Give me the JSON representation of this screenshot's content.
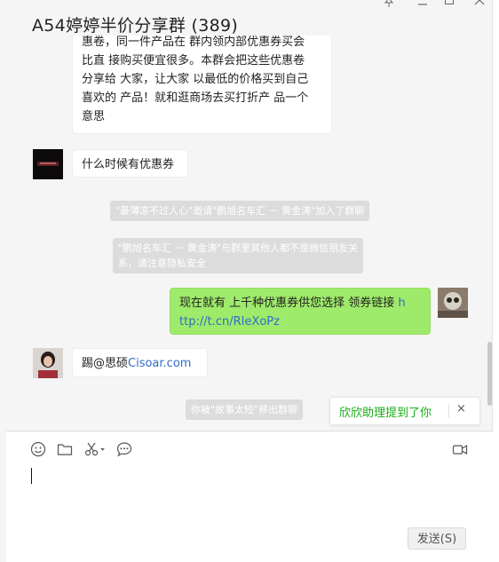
{
  "window": {
    "title": "A54婷婷半价分享群 (389)",
    "controls": [
      "pin",
      "minimize",
      "maximize",
      "close"
    ]
  },
  "messages": [
    {
      "type": "text",
      "side": "left",
      "lines": [
        "惠卷，同一件产品在 群内领内部优惠券买会",
        "比直 接购买便宜很多。本群会把这些优惠卷",
        "分享给 大家，让大家 以最低的价格买到自己",
        "喜欢的 产品！就和逛商场去买打折产 品一个",
        "意思"
      ]
    },
    {
      "type": "text",
      "side": "left",
      "avatar": "dark-avatar",
      "text": "什么时候有优惠券"
    },
    {
      "type": "system",
      "text": "\"最薄凉不过人心\"邀请\"鹏旭名车汇 － 黄金涛\"加入了群聊"
    },
    {
      "type": "system",
      "lines": [
        "\"鹏旭名车汇 － 黄金涛\"与群里其他人都不是微信朋友关",
        "系，请注意隐私安全"
      ]
    },
    {
      "type": "text",
      "side": "right",
      "avatar": "self-avatar",
      "text": "现在就有 上千种优惠券供您选择 领券链接 ",
      "link_part1": "h",
      "link_part2": "ttp://t.cn/RIeXoPz"
    },
    {
      "type": "text",
      "side": "left",
      "avatar": "girl-avatar",
      "text": "踢@思硕",
      "link": "Cisoar.com"
    },
    {
      "type": "system",
      "text": "你被\"故事太短\"移出群聊"
    }
  ],
  "mention_notice": {
    "text": "欣欣助理提到了你",
    "close": "×"
  },
  "toolbar": {
    "icons": [
      "emoji-icon",
      "folder-icon",
      "scissors-icon",
      "chat-bubble-icon",
      "video-call-icon"
    ]
  },
  "input": {
    "value": ""
  },
  "send_label": "发送(S)",
  "colors": {
    "green_bubble": "#9eea6a",
    "link": "#2f6dc7",
    "mention_text": "#1aad19"
  }
}
